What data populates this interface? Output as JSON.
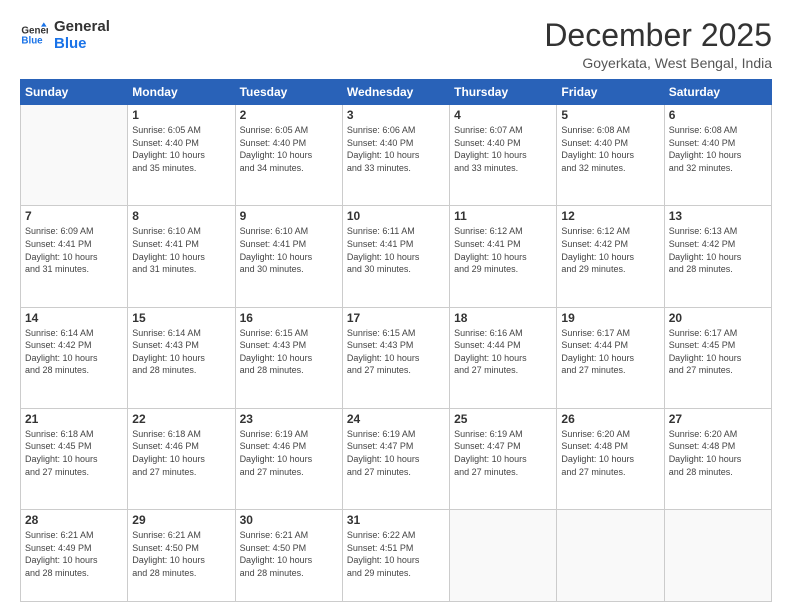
{
  "logo": {
    "line1": "General",
    "line2": "Blue"
  },
  "header": {
    "month": "December 2025",
    "location": "Goyerkata, West Bengal, India"
  },
  "weekdays": [
    "Sunday",
    "Monday",
    "Tuesday",
    "Wednesday",
    "Thursday",
    "Friday",
    "Saturday"
  ],
  "weeks": [
    [
      {
        "day": "",
        "info": ""
      },
      {
        "day": "1",
        "info": "Sunrise: 6:05 AM\nSunset: 4:40 PM\nDaylight: 10 hours\nand 35 minutes."
      },
      {
        "day": "2",
        "info": "Sunrise: 6:05 AM\nSunset: 4:40 PM\nDaylight: 10 hours\nand 34 minutes."
      },
      {
        "day": "3",
        "info": "Sunrise: 6:06 AM\nSunset: 4:40 PM\nDaylight: 10 hours\nand 33 minutes."
      },
      {
        "day": "4",
        "info": "Sunrise: 6:07 AM\nSunset: 4:40 PM\nDaylight: 10 hours\nand 33 minutes."
      },
      {
        "day": "5",
        "info": "Sunrise: 6:08 AM\nSunset: 4:40 PM\nDaylight: 10 hours\nand 32 minutes."
      },
      {
        "day": "6",
        "info": "Sunrise: 6:08 AM\nSunset: 4:40 PM\nDaylight: 10 hours\nand 32 minutes."
      }
    ],
    [
      {
        "day": "7",
        "info": "Sunrise: 6:09 AM\nSunset: 4:41 PM\nDaylight: 10 hours\nand 31 minutes."
      },
      {
        "day": "8",
        "info": "Sunrise: 6:10 AM\nSunset: 4:41 PM\nDaylight: 10 hours\nand 31 minutes."
      },
      {
        "day": "9",
        "info": "Sunrise: 6:10 AM\nSunset: 4:41 PM\nDaylight: 10 hours\nand 30 minutes."
      },
      {
        "day": "10",
        "info": "Sunrise: 6:11 AM\nSunset: 4:41 PM\nDaylight: 10 hours\nand 30 minutes."
      },
      {
        "day": "11",
        "info": "Sunrise: 6:12 AM\nSunset: 4:41 PM\nDaylight: 10 hours\nand 29 minutes."
      },
      {
        "day": "12",
        "info": "Sunrise: 6:12 AM\nSunset: 4:42 PM\nDaylight: 10 hours\nand 29 minutes."
      },
      {
        "day": "13",
        "info": "Sunrise: 6:13 AM\nSunset: 4:42 PM\nDaylight: 10 hours\nand 28 minutes."
      }
    ],
    [
      {
        "day": "14",
        "info": "Sunrise: 6:14 AM\nSunset: 4:42 PM\nDaylight: 10 hours\nand 28 minutes."
      },
      {
        "day": "15",
        "info": "Sunrise: 6:14 AM\nSunset: 4:43 PM\nDaylight: 10 hours\nand 28 minutes."
      },
      {
        "day": "16",
        "info": "Sunrise: 6:15 AM\nSunset: 4:43 PM\nDaylight: 10 hours\nand 28 minutes."
      },
      {
        "day": "17",
        "info": "Sunrise: 6:15 AM\nSunset: 4:43 PM\nDaylight: 10 hours\nand 27 minutes."
      },
      {
        "day": "18",
        "info": "Sunrise: 6:16 AM\nSunset: 4:44 PM\nDaylight: 10 hours\nand 27 minutes."
      },
      {
        "day": "19",
        "info": "Sunrise: 6:17 AM\nSunset: 4:44 PM\nDaylight: 10 hours\nand 27 minutes."
      },
      {
        "day": "20",
        "info": "Sunrise: 6:17 AM\nSunset: 4:45 PM\nDaylight: 10 hours\nand 27 minutes."
      }
    ],
    [
      {
        "day": "21",
        "info": "Sunrise: 6:18 AM\nSunset: 4:45 PM\nDaylight: 10 hours\nand 27 minutes."
      },
      {
        "day": "22",
        "info": "Sunrise: 6:18 AM\nSunset: 4:46 PM\nDaylight: 10 hours\nand 27 minutes."
      },
      {
        "day": "23",
        "info": "Sunrise: 6:19 AM\nSunset: 4:46 PM\nDaylight: 10 hours\nand 27 minutes."
      },
      {
        "day": "24",
        "info": "Sunrise: 6:19 AM\nSunset: 4:47 PM\nDaylight: 10 hours\nand 27 minutes."
      },
      {
        "day": "25",
        "info": "Sunrise: 6:19 AM\nSunset: 4:47 PM\nDaylight: 10 hours\nand 27 minutes."
      },
      {
        "day": "26",
        "info": "Sunrise: 6:20 AM\nSunset: 4:48 PM\nDaylight: 10 hours\nand 27 minutes."
      },
      {
        "day": "27",
        "info": "Sunrise: 6:20 AM\nSunset: 4:48 PM\nDaylight: 10 hours\nand 28 minutes."
      }
    ],
    [
      {
        "day": "28",
        "info": "Sunrise: 6:21 AM\nSunset: 4:49 PM\nDaylight: 10 hours\nand 28 minutes."
      },
      {
        "day": "29",
        "info": "Sunrise: 6:21 AM\nSunset: 4:50 PM\nDaylight: 10 hours\nand 28 minutes."
      },
      {
        "day": "30",
        "info": "Sunrise: 6:21 AM\nSunset: 4:50 PM\nDaylight: 10 hours\nand 28 minutes."
      },
      {
        "day": "31",
        "info": "Sunrise: 6:22 AM\nSunset: 4:51 PM\nDaylight: 10 hours\nand 29 minutes."
      },
      {
        "day": "",
        "info": ""
      },
      {
        "day": "",
        "info": ""
      },
      {
        "day": "",
        "info": ""
      }
    ]
  ]
}
